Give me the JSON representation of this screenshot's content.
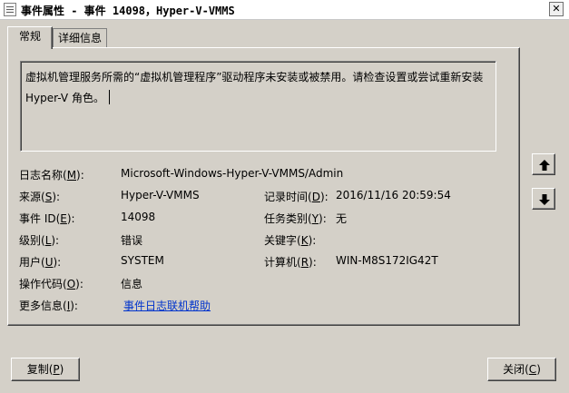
{
  "window": {
    "title": "事件属性 - 事件 14098，Hyper-V-VMMS",
    "close_symbol": "✕"
  },
  "tabs": [
    {
      "label": "常规"
    },
    {
      "label": "详细信息"
    }
  ],
  "description": {
    "line1": "虚拟机管理服务所需的“虚拟机管理程序”驱动程序未安装或被禁用。请检查设置或尝试重新安装",
    "line2": "Hyper-V 角色。"
  },
  "fields": {
    "log_name": {
      "label": "日志名称(",
      "key": "M",
      "end": "):",
      "value": "Microsoft-Windows-Hyper-V-VMMS/Admin"
    },
    "source": {
      "label": "来源(",
      "key": "S",
      "end": "):",
      "value": "Hyper-V-VMMS"
    },
    "logged": {
      "label": "记录时间(",
      "key": "D",
      "end": "):",
      "value": "2016/11/16 20:59:54"
    },
    "event_id": {
      "label": "事件 ID(",
      "key": "E",
      "end": "):",
      "value": "14098"
    },
    "task": {
      "label": "任务类别(",
      "key": "Y",
      "end": "):",
      "value": "无"
    },
    "level": {
      "label": "级别(",
      "key": "L",
      "end": "):",
      "value": "错误"
    },
    "keywords": {
      "label": "关键字(",
      "key": "K",
      "end": "):",
      "value": ""
    },
    "user": {
      "label": "用户(",
      "key": "U",
      "end": "):",
      "value": "SYSTEM"
    },
    "computer": {
      "label": "计算机(",
      "key": "R",
      "end": "):",
      "value": "WIN-M8S172IG42T"
    },
    "opcode": {
      "label": "操作代码(",
      "key": "O",
      "end": "):",
      "value": "信息"
    },
    "more_info": {
      "label": "更多信息(",
      "key": "I",
      "end": "):",
      "value": "事件日志联机帮助"
    }
  },
  "buttons": {
    "copy": {
      "label": "复制(",
      "key": "P",
      "end": ")"
    },
    "close": {
      "label": "关闭(",
      "key": "C",
      "end": ")"
    }
  },
  "icons": {
    "up": "arrow-up-icon",
    "down": "arrow-down-icon"
  }
}
